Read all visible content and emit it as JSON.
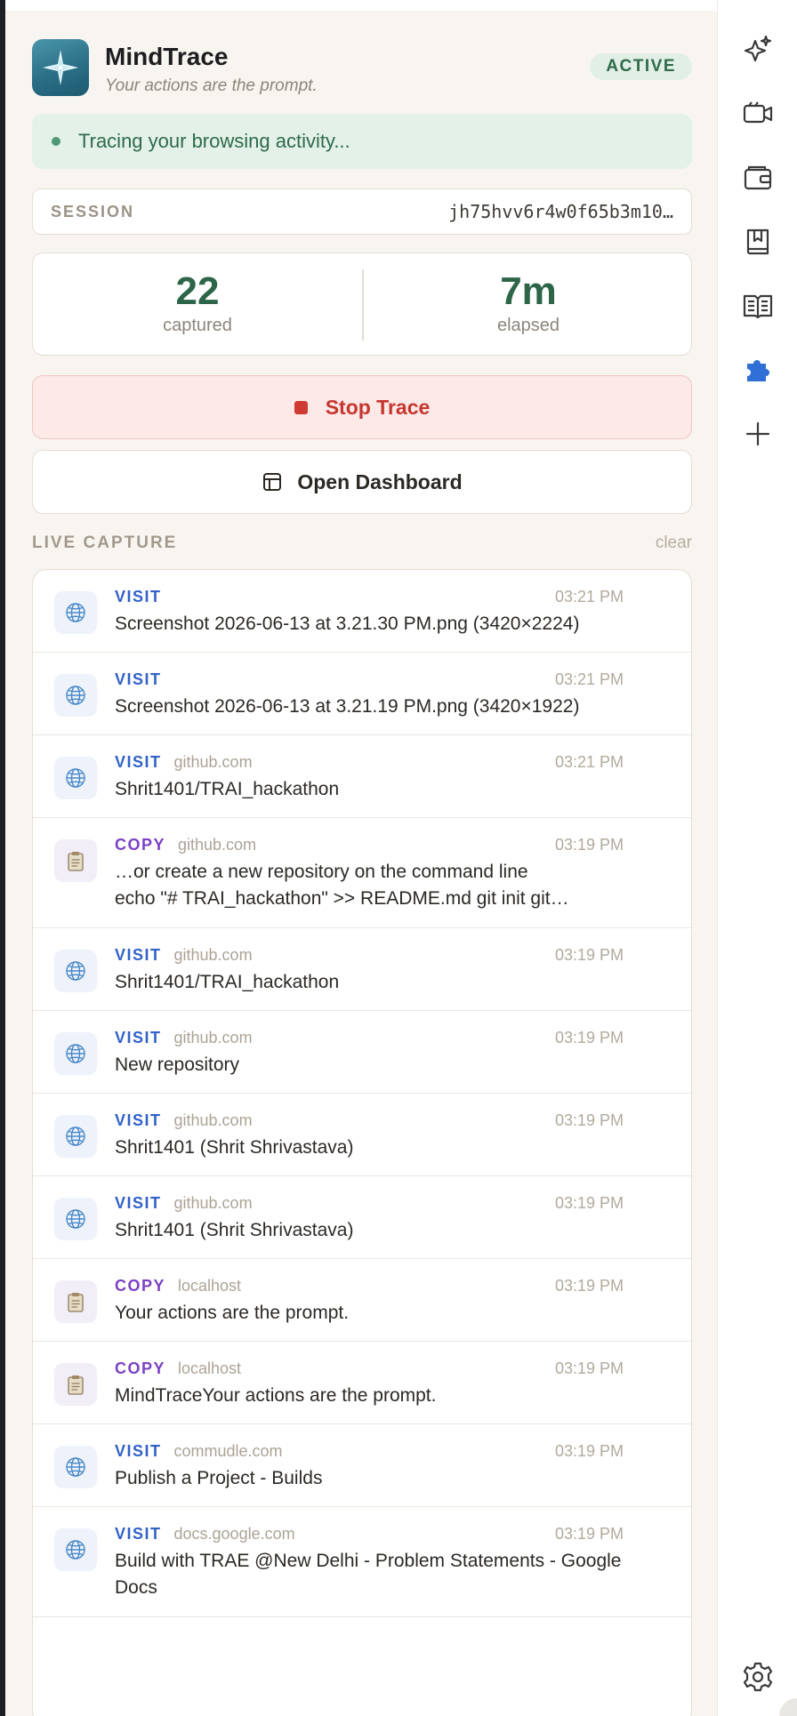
{
  "app": {
    "title": "MindTrace",
    "subtitle": "Your actions are the prompt.",
    "status": "ACTIVE"
  },
  "banner": {
    "text": "Tracing your browsing activity..."
  },
  "session": {
    "label": "SESSION",
    "id": "jh75hvv6r4w0f65b3m10…"
  },
  "stats": {
    "captured_value": "22",
    "captured_label": "captured",
    "elapsed_value": "7m",
    "elapsed_label": "elapsed"
  },
  "actions": {
    "stop_label": "Stop Trace",
    "dashboard_label": "Open Dashboard"
  },
  "live": {
    "title": "LIVE CAPTURE",
    "clear_label": "clear"
  },
  "feed": [
    {
      "kind": "VISIT",
      "domain": "",
      "time": "03:21 PM",
      "text": "Screenshot 2026-06-13 at 3.21.30 PM.png (3420×2224)"
    },
    {
      "kind": "VISIT",
      "domain": "",
      "time": "03:21 PM",
      "text": "Screenshot 2026-06-13 at 3.21.19 PM.png (3420×1922)"
    },
    {
      "kind": "VISIT",
      "domain": "github.com",
      "time": "03:21 PM",
      "text": "Shrit1401/TRAI_hackathon"
    },
    {
      "kind": "COPY",
      "domain": "github.com",
      "time": "03:19 PM",
      "text": "…or create a new repository on the command line",
      "text2": "echo \"# TRAI_hackathon\" >> README.md git init git…"
    },
    {
      "kind": "VISIT",
      "domain": "github.com",
      "time": "03:19 PM",
      "text": "Shrit1401/TRAI_hackathon"
    },
    {
      "kind": "VISIT",
      "domain": "github.com",
      "time": "03:19 PM",
      "text": "New repository"
    },
    {
      "kind": "VISIT",
      "domain": "github.com",
      "time": "03:19 PM",
      "text": "Shrit1401 (Shrit Shrivastava)"
    },
    {
      "kind": "VISIT",
      "domain": "github.com",
      "time": "03:19 PM",
      "text": "Shrit1401 (Shrit Shrivastava)"
    },
    {
      "kind": "COPY",
      "domain": "localhost",
      "time": "03:19 PM",
      "text": "Your actions are the prompt."
    },
    {
      "kind": "COPY",
      "domain": "localhost",
      "time": "03:19 PM",
      "text": "MindTraceYour actions are the prompt."
    },
    {
      "kind": "VISIT",
      "domain": "commudle.com",
      "time": "03:19 PM",
      "text": "Publish a Project - Builds"
    },
    {
      "kind": "VISIT",
      "domain": "docs.google.com",
      "time": "03:19 PM",
      "text": "Build with TRAE @New Delhi - Problem Statements - Google Docs"
    }
  ],
  "rail": {
    "icons": [
      "sparkle-star-icon",
      "video-camera-icon",
      "wallet-icon",
      "bookmark-book-icon",
      "open-book-icon",
      "puzzle-extension-icon",
      "plus-icon",
      "settings-gear-icon"
    ]
  },
  "colors": {
    "accent_green": "#2d6549",
    "stop_red": "#c6362e",
    "visit_blue": "#3161c9",
    "copy_purple": "#7b41c4",
    "panel_bg": "#f8f5f1"
  }
}
